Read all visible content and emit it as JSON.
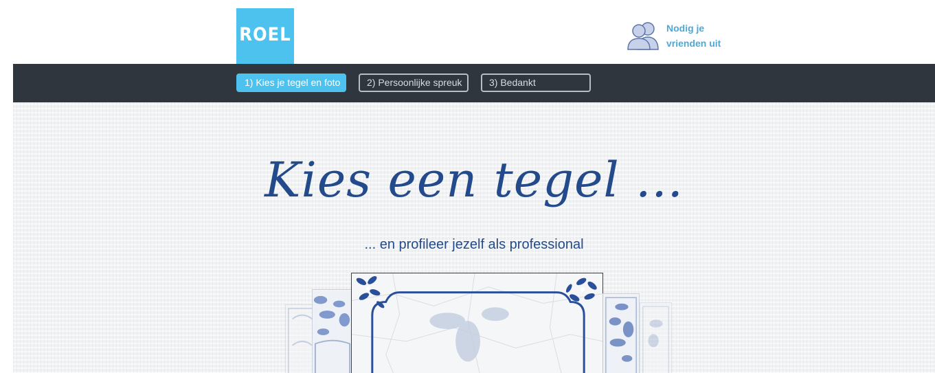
{
  "header": {
    "logo_text": "ROEL",
    "invite_label": "Nodig je vrienden uit",
    "invite_icon": "friends-icon"
  },
  "nav": {
    "steps": [
      {
        "label": "1) Kies je tegel en foto",
        "active": true
      },
      {
        "label": "2) Persoonlijke spreuk",
        "active": false
      },
      {
        "label": "3) Bedankt",
        "active": false
      }
    ]
  },
  "main": {
    "title": "Kies een tegel ...",
    "subtitle": "... en profileer jezelf als professional"
  },
  "colors": {
    "accent": "#4ec2ee",
    "navbar": "#2f363e",
    "title": "#234a8a",
    "delft_blue": "#2a4f9a"
  }
}
